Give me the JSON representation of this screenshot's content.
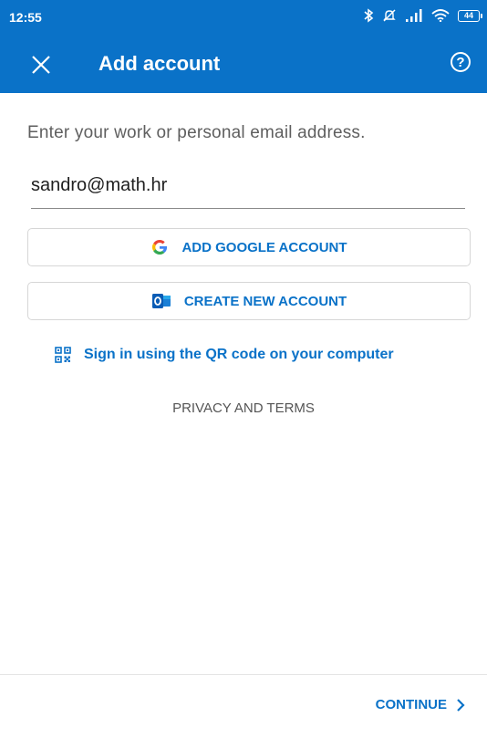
{
  "status_bar": {
    "time": "12:55",
    "battery": "44"
  },
  "app_bar": {
    "title": "Add account",
    "help_glyph": "?"
  },
  "main": {
    "instruction": "Enter your work or personal email address.",
    "email_value": "sandro@math.hr",
    "google_button_label": "ADD GOOGLE ACCOUNT",
    "create_button_label": "CREATE NEW ACCOUNT",
    "qr_link_label": "Sign in using the QR code on your computer",
    "privacy_label": "PRIVACY AND TERMS"
  },
  "footer": {
    "continue_label": "CONTINUE"
  },
  "colors": {
    "accent": "#0a72c8",
    "text_muted": "#5f5f5f",
    "border": "#d6d6d6"
  },
  "icons": [
    "bluetooth-icon",
    "mute-icon",
    "signal-icon",
    "wifi-icon",
    "battery-icon",
    "close-icon",
    "help-icon",
    "google-logo-icon",
    "outlook-logo-icon",
    "qr-code-icon",
    "chevron-right-icon"
  ]
}
